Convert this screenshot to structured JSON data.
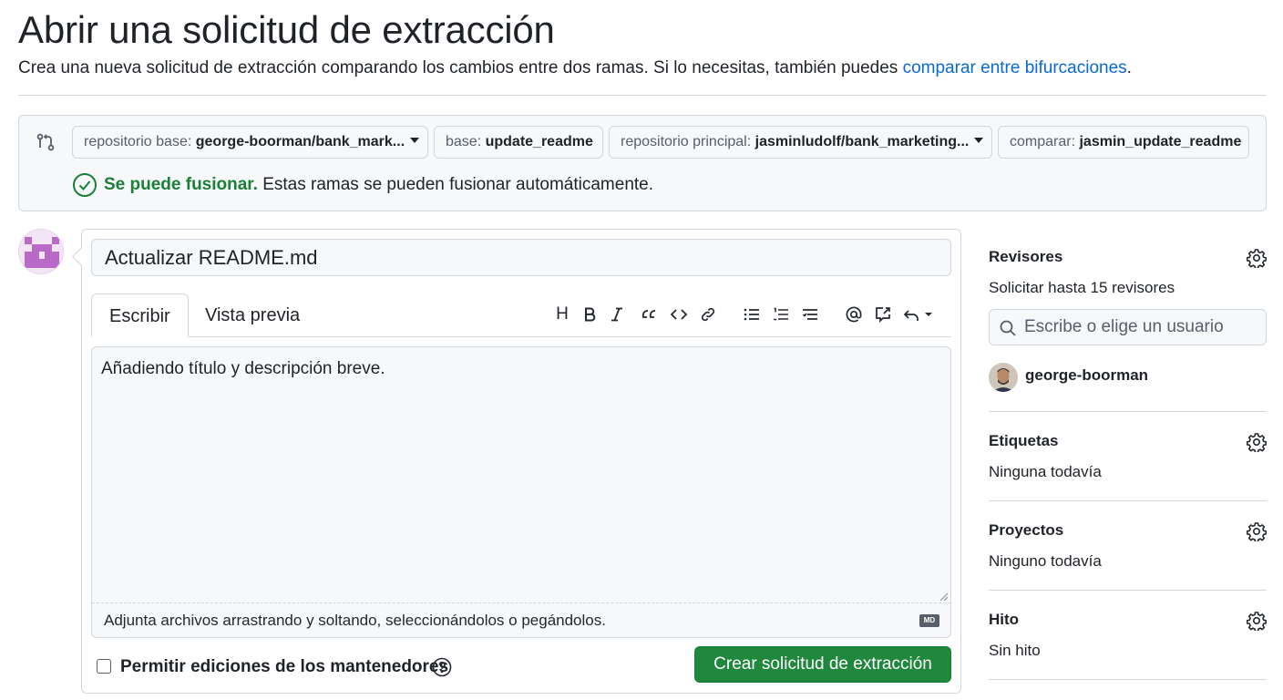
{
  "header": {
    "title": "Abrir una solicitud de extracción",
    "subtitle_text": "Crea una nueva solicitud de extracción comparando los cambios entre dos ramas. Si lo necesitas, también puedes ",
    "subtitle_link": "comparar entre bifurcaciones",
    "subtitle_end": "."
  },
  "compare": {
    "base_repo_label": "repositorio base:",
    "base_repo_value": "george-boorman/bank_mark...",
    "base_label": "base:",
    "base_value": "update_readme",
    "head_repo_label": "repositorio principal:",
    "head_repo_value": "jasminludolf/bank_marketing...",
    "compare_label": "comparar:",
    "compare_value": "jasmin_update_readme",
    "merge_ok": "Se puede fusionar.",
    "merge_msg": "Estas ramas se pueden fusionar automáticamente."
  },
  "form": {
    "title_value": "Actualizar README.md",
    "tab_write": "Escribir",
    "tab_preview": "Vista previa",
    "body_text": "Añadiendo título y descripción breve.",
    "attach_hint": "Adjunta archivos arrastrando y soltando, seleccionándolos o pegándolos.",
    "md_badge": "MD",
    "allow_edits": "Permitir ediciones de los mantenedores",
    "create_button": "Crear solicitud de extracción",
    "toolbar_heading": "H"
  },
  "sidebar": {
    "reviewers_heading": "Revisores",
    "reviewers_sub": "Solicitar hasta 15 revisores",
    "reviewer_search_placeholder": "Escribe o elige un usuario",
    "reviewer_name": "george-boorman",
    "labels_heading": "Etiquetas",
    "labels_value": "Ninguna todavía",
    "projects_heading": "Proyectos",
    "projects_value": "Ninguno todavía",
    "milestone_heading": "Hito",
    "milestone_value": "Sin hito"
  },
  "colors": {
    "accent_link": "#0969da",
    "success_green": "#1a7f37",
    "button_green": "#1f883d",
    "border": "#d0d7de"
  }
}
